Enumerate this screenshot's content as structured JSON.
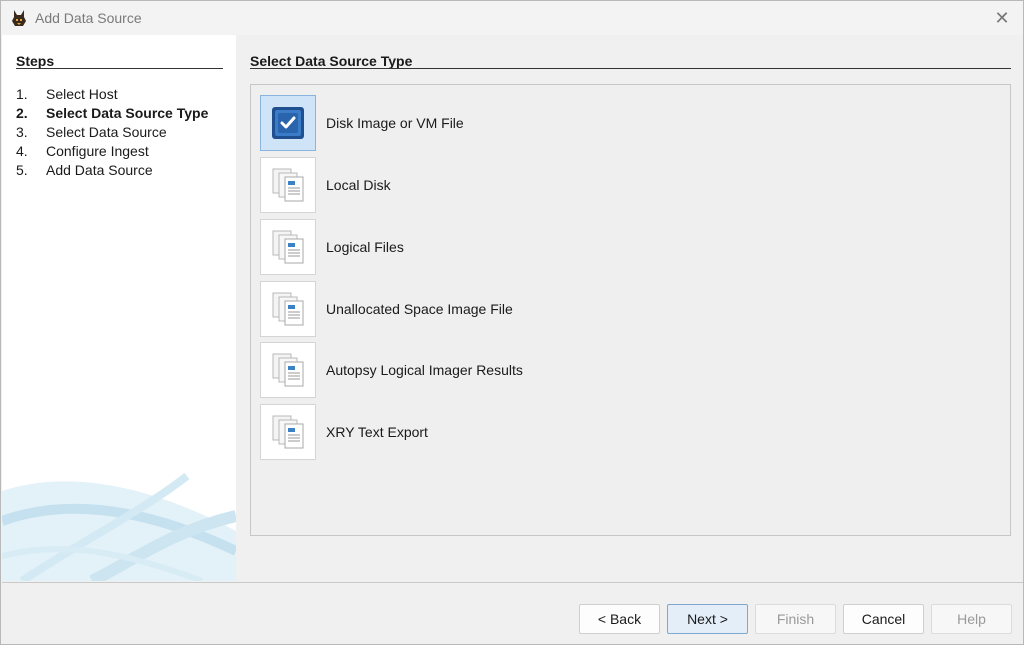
{
  "window": {
    "title": "Add Data Source"
  },
  "steps": {
    "heading": "Steps",
    "items": [
      {
        "num": "1.",
        "label": "Select Host"
      },
      {
        "num": "2.",
        "label": "Select Data Source Type"
      },
      {
        "num": "3.",
        "label": "Select Data Source"
      },
      {
        "num": "4.",
        "label": "Configure Ingest"
      },
      {
        "num": "5.",
        "label": "Add Data Source"
      }
    ],
    "current_index": 1
  },
  "main": {
    "heading": "Select Data Source Type",
    "types": [
      {
        "label": "Disk Image or VM File",
        "selected": true,
        "icon": "disk-image-icon"
      },
      {
        "label": "Local Disk",
        "selected": false,
        "icon": "file-stack-icon"
      },
      {
        "label": "Logical Files",
        "selected": false,
        "icon": "file-stack-icon"
      },
      {
        "label": "Unallocated Space Image File",
        "selected": false,
        "icon": "file-stack-icon"
      },
      {
        "label": "Autopsy Logical Imager Results",
        "selected": false,
        "icon": "file-stack-icon"
      },
      {
        "label": "XRY Text Export",
        "selected": false,
        "icon": "file-stack-icon"
      }
    ]
  },
  "footer": {
    "back": "< Back",
    "next": "Next >",
    "finish": "Finish",
    "cancel": "Cancel",
    "help": "Help"
  },
  "colors": {
    "selection": "#cfe4f7",
    "accent": "#2f6db5"
  }
}
